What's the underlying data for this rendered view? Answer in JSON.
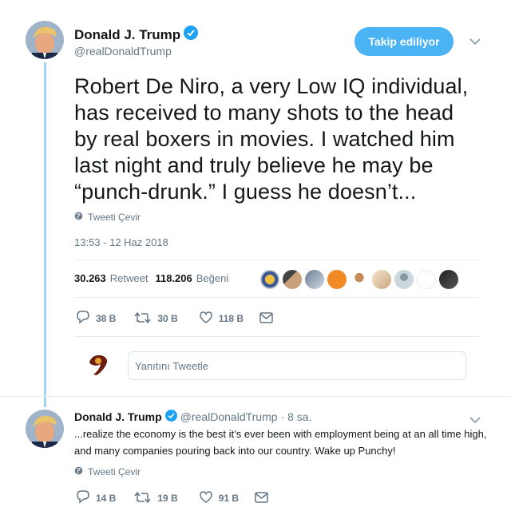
{
  "main_tweet": {
    "name": "Donald J. Trump",
    "handle": "@realDonaldTrump",
    "follow_label": "Takip ediliyor",
    "text": "Robert De Niro, a very Low IQ individual, has received to many shots to the head by real boxers in movies. I watched him last night and truly believe he may be “punch-drunk.” I guess he doesn’t...",
    "translate_label": "Tweeti Çevir",
    "timestamp": "13:53 - 12 Haz 2018",
    "retweet_count": "30.263",
    "retweet_label": "Retweet",
    "like_count": "118.206",
    "like_label": "Beğeni",
    "actions": {
      "replies": "38 B",
      "retweets": "30 B",
      "likes": "118 B"
    },
    "icons": [
      "verified-badge",
      "globe-icon",
      "reply-icon",
      "retweet-icon",
      "heart-icon",
      "dm-icon",
      "chevron-down-icon"
    ]
  },
  "reply_box": {
    "placeholder": "Yanıtını Tweetle"
  },
  "reply_tweet": {
    "name": "Donald J. Trump",
    "handle": "@realDonaldTrump",
    "time": "· 8 sa.",
    "text": "...realize the economy is the best it’s ever been with employment being at an all time high, and many companies pouring back into our country. Wake up Punchy!",
    "translate_label": "Tweeti Çevir",
    "actions": {
      "replies": "14 B",
      "retweets": "19 B",
      "likes": "91 B"
    }
  },
  "colors": {
    "accent": "#1da1f2",
    "follow_button": "#4ab3f4",
    "thread_line": "#a0d2f5",
    "muted": "#657786"
  }
}
